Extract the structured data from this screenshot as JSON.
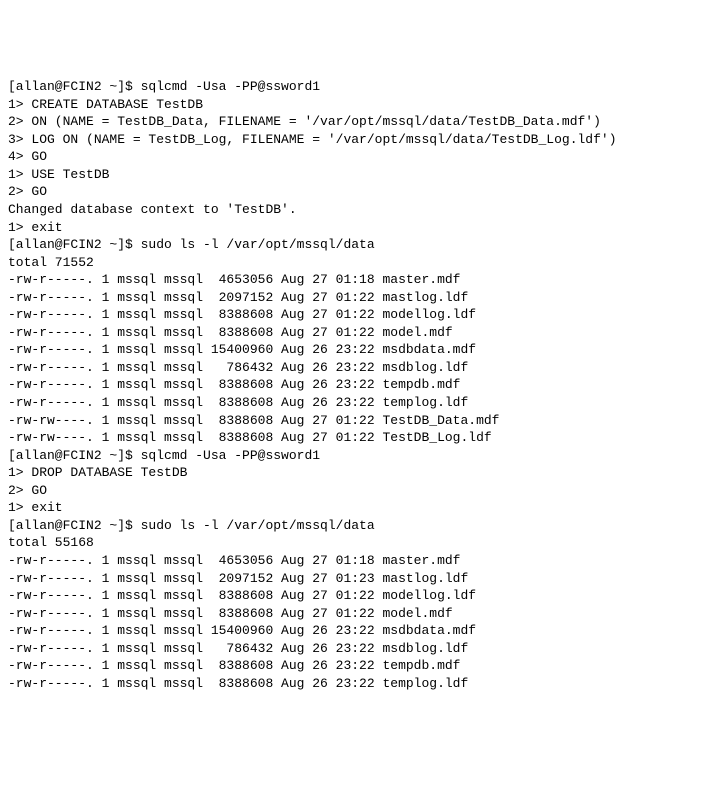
{
  "lines": [
    "[allan@FCIN2 ~]$ sqlcmd -Usa -PP@ssword1",
    "1> CREATE DATABASE TestDB",
    "2> ON (NAME = TestDB_Data, FILENAME = '/var/opt/mssql/data/TestDB_Data.mdf')",
    "3> LOG ON (NAME = TestDB_Log, FILENAME = '/var/opt/mssql/data/TestDB_Log.ldf')",
    "4> GO",
    "1> USE TestDB",
    "2> GO",
    "Changed database context to 'TestDB'.",
    "1> exit",
    "[allan@FCIN2 ~]$ sudo ls -l /var/opt/mssql/data",
    "total 71552",
    "-rw-r-----. 1 mssql mssql  4653056 Aug 27 01:18 master.mdf",
    "-rw-r-----. 1 mssql mssql  2097152 Aug 27 01:22 mastlog.ldf",
    "-rw-r-----. 1 mssql mssql  8388608 Aug 27 01:22 modellog.ldf",
    "-rw-r-----. 1 mssql mssql  8388608 Aug 27 01:22 model.mdf",
    "-rw-r-----. 1 mssql mssql 15400960 Aug 26 23:22 msdbdata.mdf",
    "-rw-r-----. 1 mssql mssql   786432 Aug 26 23:22 msdblog.ldf",
    "-rw-r-----. 1 mssql mssql  8388608 Aug 26 23:22 tempdb.mdf",
    "-rw-r-----. 1 mssql mssql  8388608 Aug 26 23:22 templog.ldf",
    "-rw-rw----. 1 mssql mssql  8388608 Aug 27 01:22 TestDB_Data.mdf",
    "-rw-rw----. 1 mssql mssql  8388608 Aug 27 01:22 TestDB_Log.ldf",
    "[allan@FCIN2 ~]$ sqlcmd -Usa -PP@ssword1",
    "1> DROP DATABASE TestDB",
    "2> GO",
    "1> exit",
    "[allan@FCIN2 ~]$ sudo ls -l /var/opt/mssql/data",
    "total 55168",
    "-rw-r-----. 1 mssql mssql  4653056 Aug 27 01:18 master.mdf",
    "-rw-r-----. 1 mssql mssql  2097152 Aug 27 01:23 mastlog.ldf",
    "-rw-r-----. 1 mssql mssql  8388608 Aug 27 01:22 modellog.ldf",
    "-rw-r-----. 1 mssql mssql  8388608 Aug 27 01:22 model.mdf",
    "-rw-r-----. 1 mssql mssql 15400960 Aug 26 23:22 msdbdata.mdf",
    "-rw-r-----. 1 mssql mssql   786432 Aug 26 23:22 msdblog.ldf",
    "-rw-r-----. 1 mssql mssql  8388608 Aug 26 23:22 tempdb.mdf",
    "-rw-r-----. 1 mssql mssql  8388608 Aug 26 23:22 templog.ldf"
  ]
}
